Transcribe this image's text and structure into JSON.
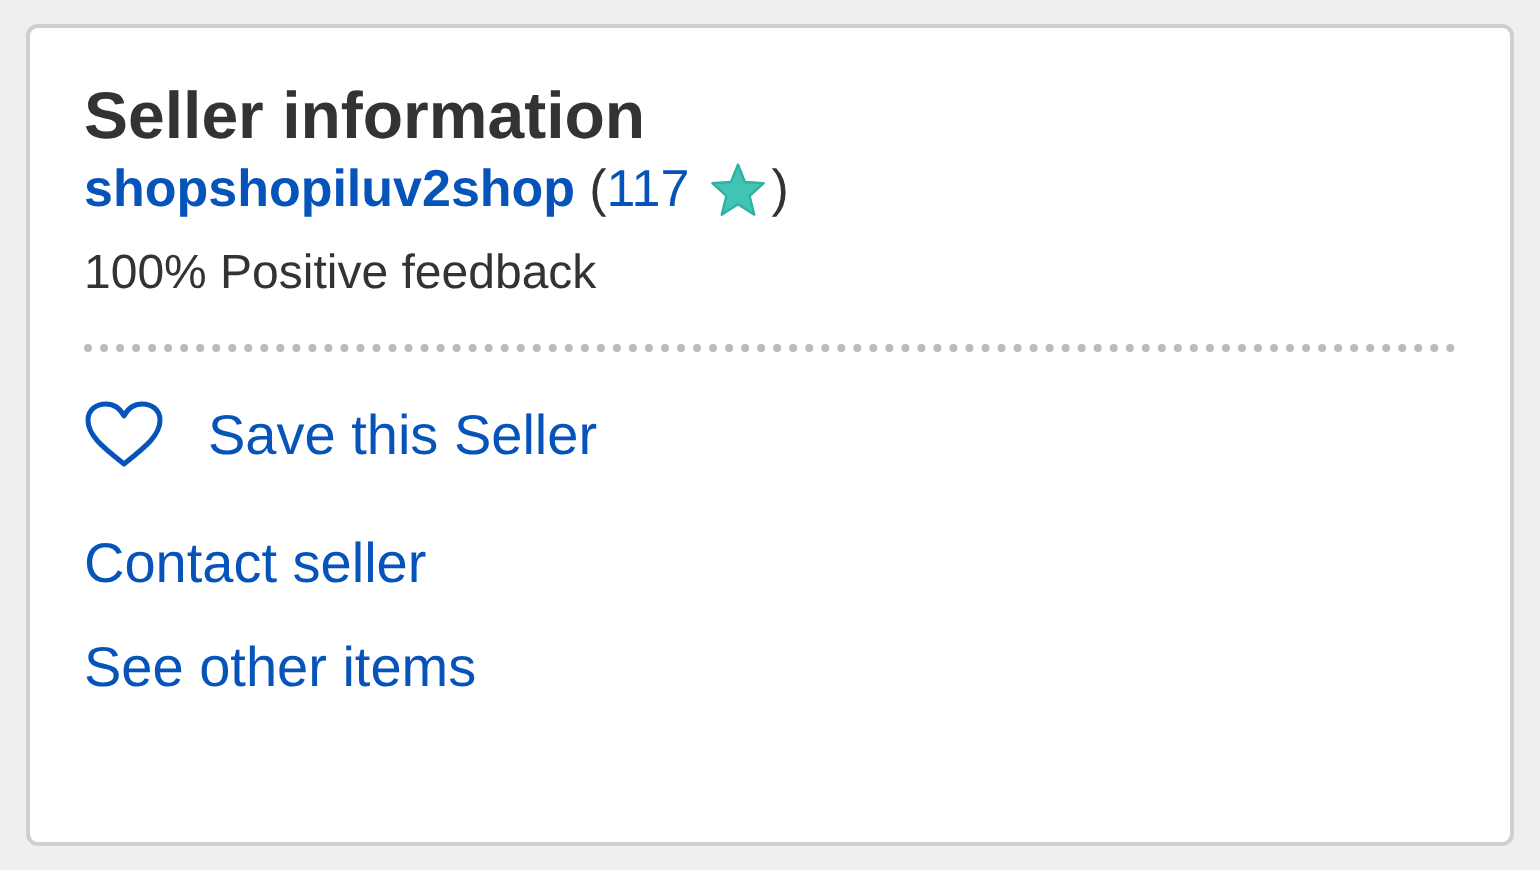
{
  "panel": {
    "title": "Seller information",
    "seller": {
      "name": "shopshopiluv2shop",
      "open_paren": "(",
      "feedback_score": "117",
      "close_paren": ")"
    },
    "feedback": "100% Positive feedback",
    "save": {
      "label": "Save this Seller",
      "saved": false
    },
    "links": [
      "Contact seller",
      "See other items"
    ]
  }
}
